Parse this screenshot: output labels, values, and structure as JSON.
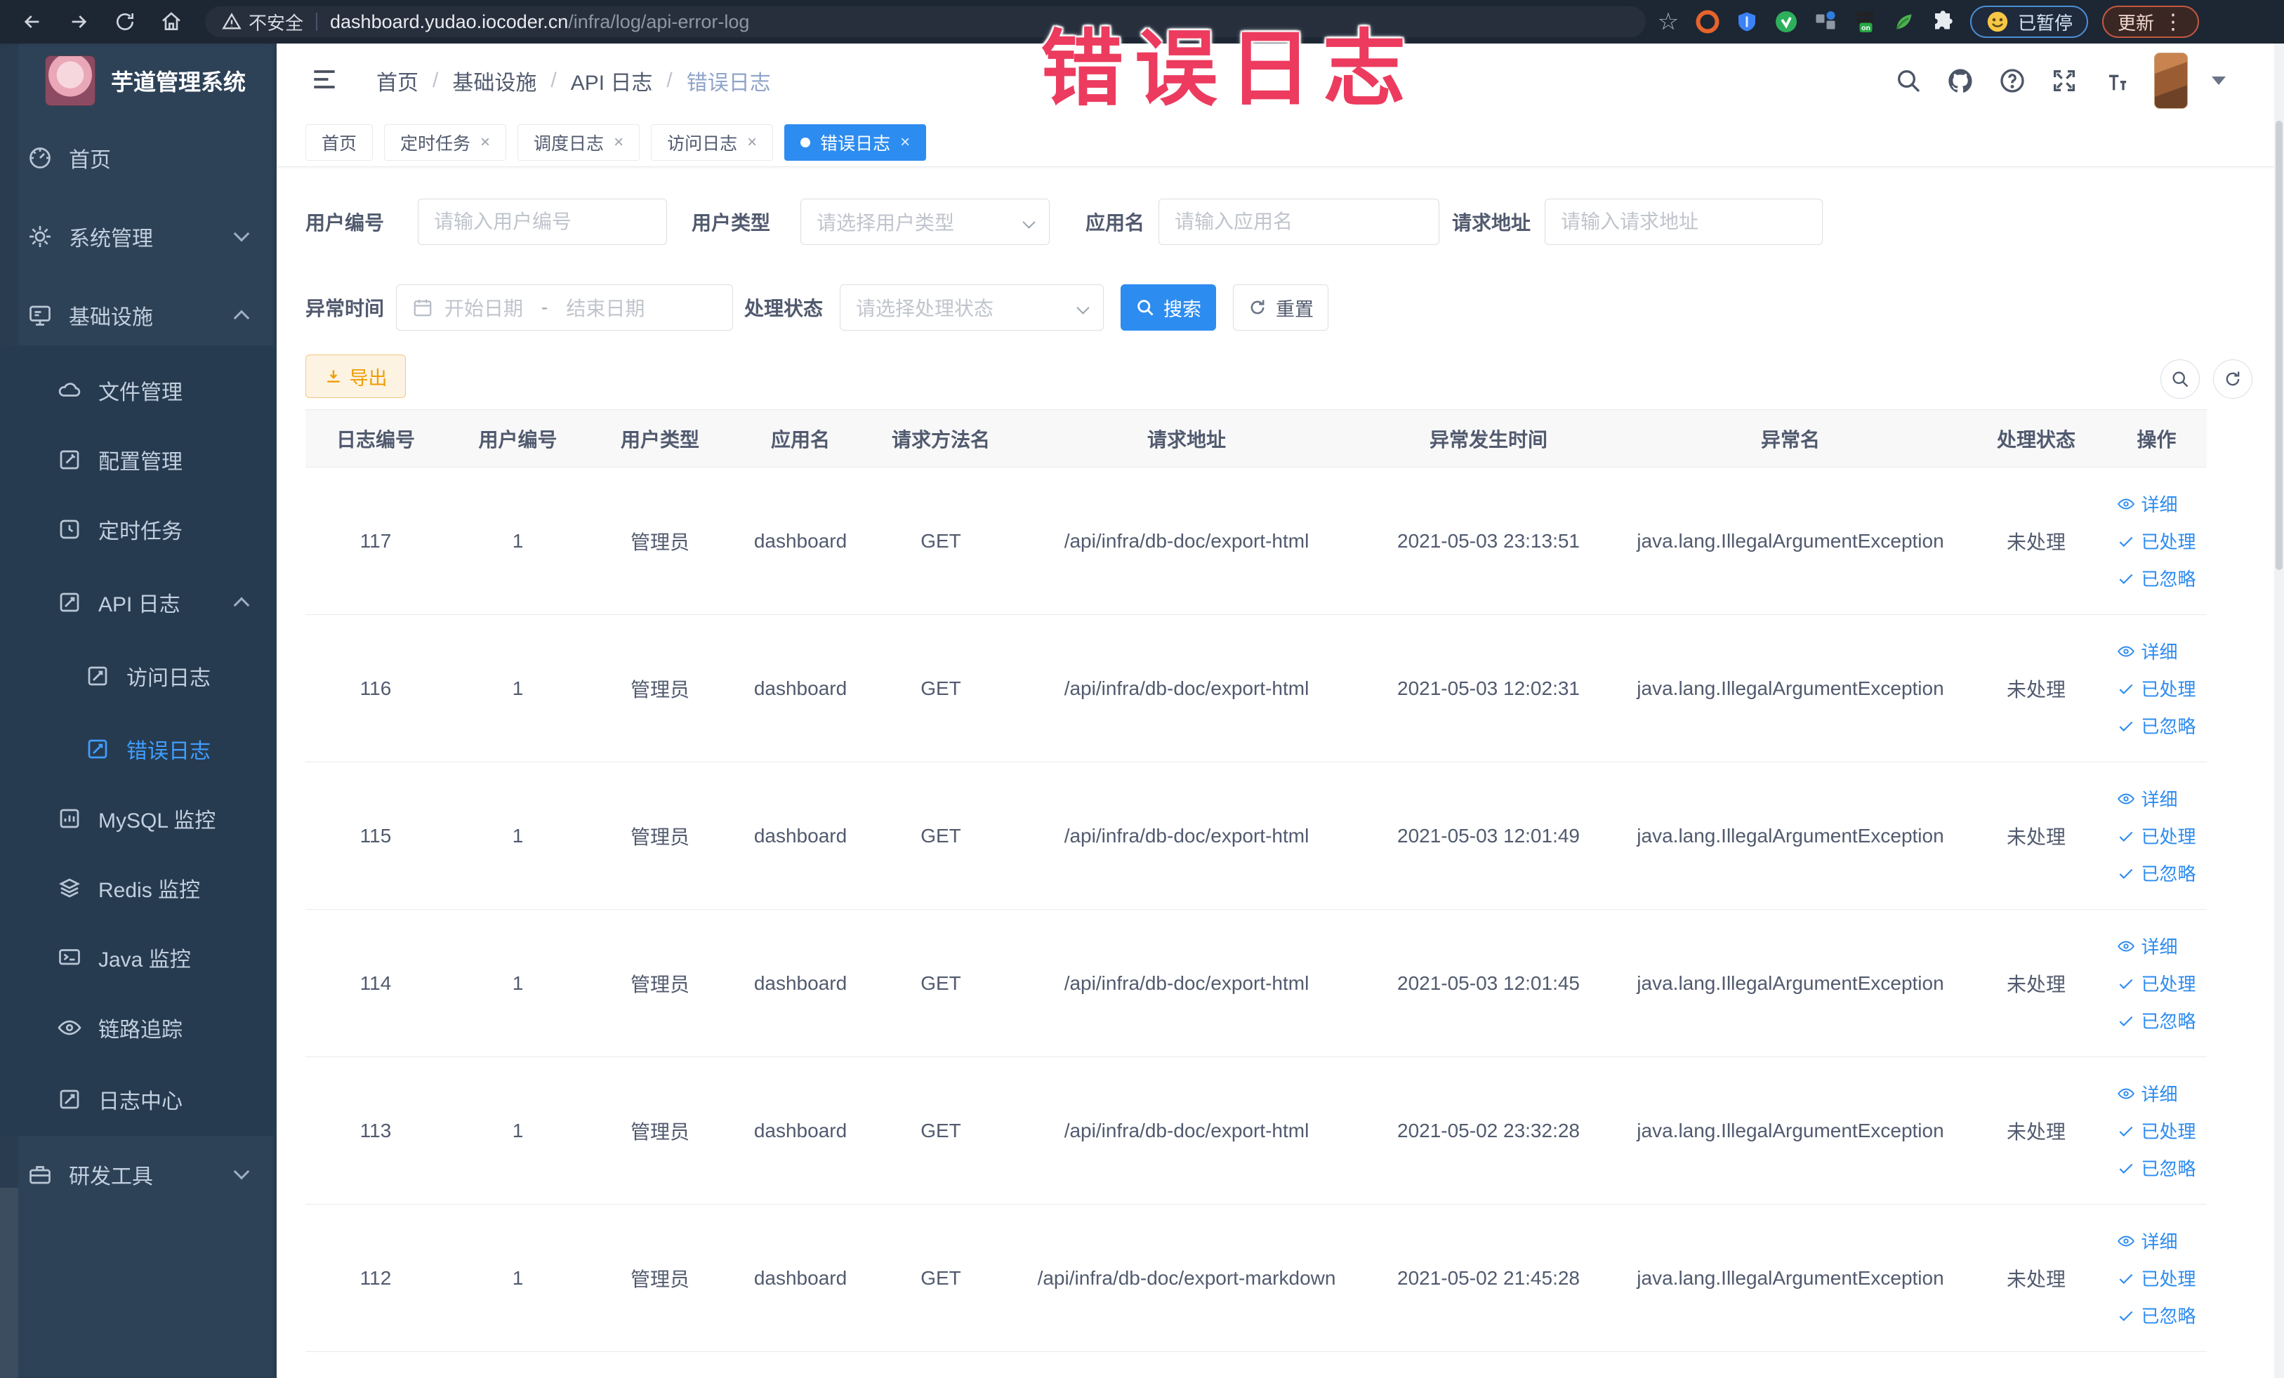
{
  "browser": {
    "security_label": "不安全",
    "url_host": "dashboard.yudao.iocoder.cn",
    "url_path": "/infra/log/api-error-log",
    "paused_label": "已暂停",
    "update_label": "更新",
    "glyphs": {
      "star": "☆",
      "kebab": "⋮"
    }
  },
  "annotation": {
    "text": "错误日志"
  },
  "sidebar": {
    "title": "芋道管理系统",
    "items": [
      {
        "label": "首页"
      },
      {
        "label": "系统管理"
      },
      {
        "label": "基础设施"
      },
      {
        "label": "文件管理"
      },
      {
        "label": "配置管理"
      },
      {
        "label": "定时任务"
      },
      {
        "label": "API 日志"
      },
      {
        "label": "访问日志"
      },
      {
        "label": "错误日志"
      },
      {
        "label": "MySQL 监控"
      },
      {
        "label": "Redis 监控"
      },
      {
        "label": "Java 监控"
      },
      {
        "label": "链路追踪"
      },
      {
        "label": "日志中心"
      },
      {
        "label": "研发工具"
      }
    ]
  },
  "header": {
    "breadcrumb": [
      "首页",
      "基础设施",
      "API 日志",
      "错误日志"
    ]
  },
  "tabs": [
    {
      "label": "首页"
    },
    {
      "label": "定时任务"
    },
    {
      "label": "调度日志"
    },
    {
      "label": "访问日志"
    },
    {
      "label": "错误日志"
    }
  ],
  "filters": {
    "user_id_label": "用户编号",
    "user_id_placeholder": "请输入用户编号",
    "user_type_label": "用户类型",
    "user_type_placeholder": "请选择用户类型",
    "app_label": "应用名",
    "app_placeholder": "请输入应用名",
    "url_label": "请求地址",
    "url_placeholder": "请输入请求地址",
    "time_label": "异常时间",
    "time_start_placeholder": "开始日期",
    "time_separator": "-",
    "time_end_placeholder": "结束日期",
    "status_label": "处理状态",
    "status_placeholder": "请选择处理状态",
    "search_label": "搜索",
    "reset_label": "重置"
  },
  "toolbar": {
    "export_label": "导出"
  },
  "table": {
    "columns": [
      "日志编号",
      "用户编号",
      "用户类型",
      "应用名",
      "请求方法名",
      "请求地址",
      "异常发生时间",
      "异常名",
      "处理状态",
      "操作"
    ],
    "actions": {
      "detail": "详细",
      "processed": "已处理",
      "ignored": "已忽略"
    },
    "rows": [
      {
        "id": "117",
        "user_id": "1",
        "user_type": "管理员",
        "app": "dashboard",
        "method": "GET",
        "url": "/api/infra/db-doc/export-html",
        "time": "2021-05-03 23:13:51",
        "exception": "java.lang.IllegalArgumentException",
        "status": "未处理"
      },
      {
        "id": "116",
        "user_id": "1",
        "user_type": "管理员",
        "app": "dashboard",
        "method": "GET",
        "url": "/api/infra/db-doc/export-html",
        "time": "2021-05-03 12:02:31",
        "exception": "java.lang.IllegalArgumentException",
        "status": "未处理"
      },
      {
        "id": "115",
        "user_id": "1",
        "user_type": "管理员",
        "app": "dashboard",
        "method": "GET",
        "url": "/api/infra/db-doc/export-html",
        "time": "2021-05-03 12:01:49",
        "exception": "java.lang.IllegalArgumentException",
        "status": "未处理"
      },
      {
        "id": "114",
        "user_id": "1",
        "user_type": "管理员",
        "app": "dashboard",
        "method": "GET",
        "url": "/api/infra/db-doc/export-html",
        "time": "2021-05-03 12:01:45",
        "exception": "java.lang.IllegalArgumentException",
        "status": "未处理"
      },
      {
        "id": "113",
        "user_id": "1",
        "user_type": "管理员",
        "app": "dashboard",
        "method": "GET",
        "url": "/api/infra/db-doc/export-html",
        "time": "2021-05-02 23:32:28",
        "exception": "java.lang.IllegalArgumentException",
        "status": "未处理"
      },
      {
        "id": "112",
        "user_id": "1",
        "user_type": "管理员",
        "app": "dashboard",
        "method": "GET",
        "url": "/api/infra/db-doc/export-markdown",
        "time": "2021-05-02 21:45:28",
        "exception": "java.lang.IllegalArgumentException",
        "status": "未处理"
      }
    ]
  }
}
